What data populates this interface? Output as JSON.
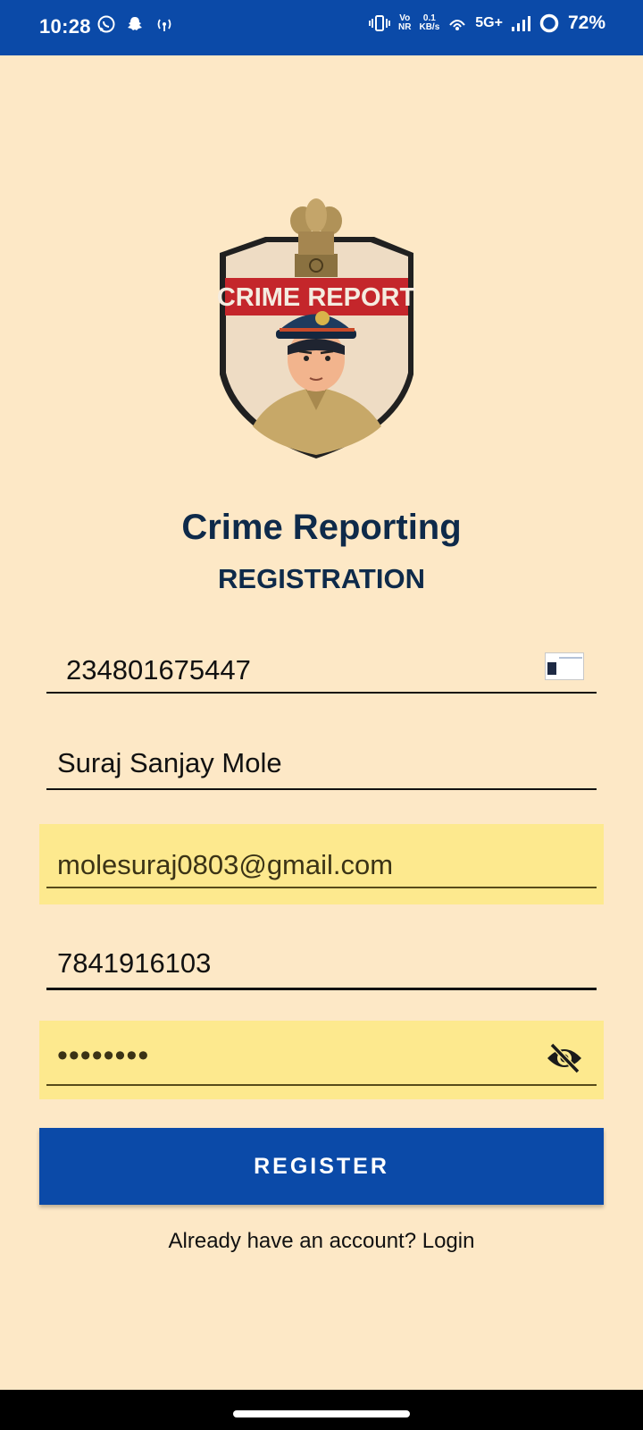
{
  "status_bar": {
    "time": "10:28",
    "left_icons": [
      "whatsapp-icon",
      "snapchat-icon",
      "hotspot-icon"
    ],
    "volte_top": "Vo",
    "volte_bottom": "NR",
    "speed_top": "0.1",
    "speed_bottom": "KB/s",
    "network": "5G+",
    "battery": "72%"
  },
  "app": {
    "logo_text": "CRIME REPORT",
    "title": "Crime Reporting",
    "subtitle": "REGISTRATION"
  },
  "form": {
    "aadhaar_value": "234801675447",
    "name_value": "Suraj Sanjay Mole",
    "email_value": "molesuraj0803@gmail.com",
    "phone_value": "7841916103",
    "password_masked": "••••••••",
    "register_label": "REGISTER",
    "login_link": "Already have an account? Login"
  },
  "colors": {
    "background": "#fde8c6",
    "primary": "#0b4aa8",
    "autofill": "#fde98e",
    "title": "#0e2a4a"
  }
}
